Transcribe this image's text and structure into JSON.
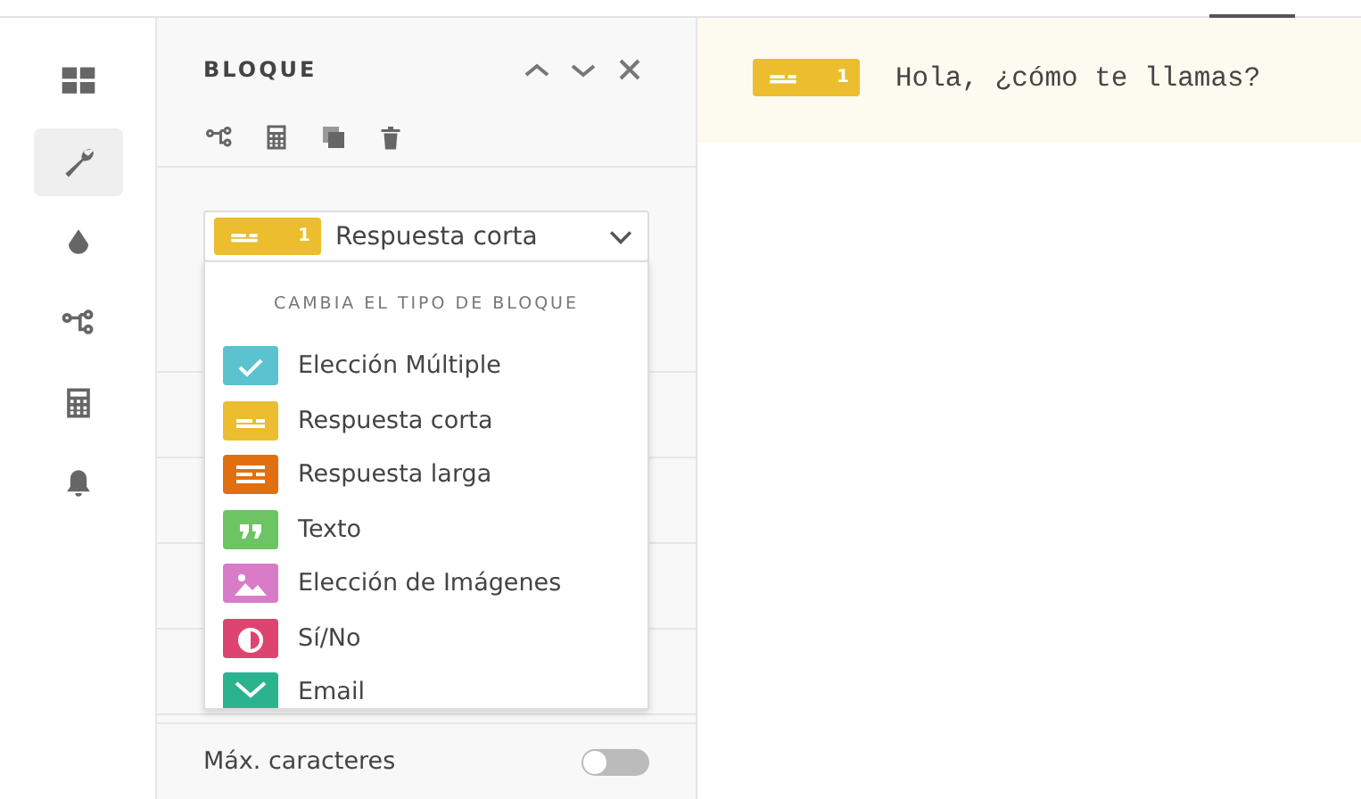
{
  "rail": [
    {
      "kind": "grid",
      "selected": false
    },
    {
      "kind": "wrench",
      "selected": true
    },
    {
      "kind": "drop",
      "selected": false
    },
    {
      "kind": "flow",
      "selected": false
    },
    {
      "kind": "calc",
      "selected": false
    },
    {
      "kind": "bell",
      "selected": false
    }
  ],
  "panel": {
    "title": "BLOQUE",
    "block_type": {
      "kind": "short",
      "color": "#ebbd2f",
      "number": "1",
      "label": "Respuesta corta"
    },
    "dropdown": {
      "heading": "CAMBIA EL TIPO DE BLOQUE",
      "items": [
        {
          "kind": "check",
          "color": "#5bc3cf",
          "label": "Elección Múltiple"
        },
        {
          "kind": "short",
          "color": "#ebbd2f",
          "label": "Respuesta corta"
        },
        {
          "kind": "long",
          "color": "#e0700f",
          "label": "Respuesta larga"
        },
        {
          "kind": "quote",
          "color": "#6cc463",
          "label": "Texto"
        },
        {
          "kind": "image",
          "color": "#d87cc8",
          "label": "Elección de Imágenes"
        },
        {
          "kind": "yesno",
          "color": "#de4470",
          "label": "Sí/No"
        },
        {
          "kind": "mail",
          "color": "#2bb38e",
          "label": "Email"
        }
      ]
    },
    "max_chars": {
      "label": "Máx. caracteres",
      "on": false
    }
  },
  "question": {
    "kind": "short",
    "color": "#ebbd2f",
    "number": "1",
    "text": "Hola, ¿cómo te llamas?"
  }
}
